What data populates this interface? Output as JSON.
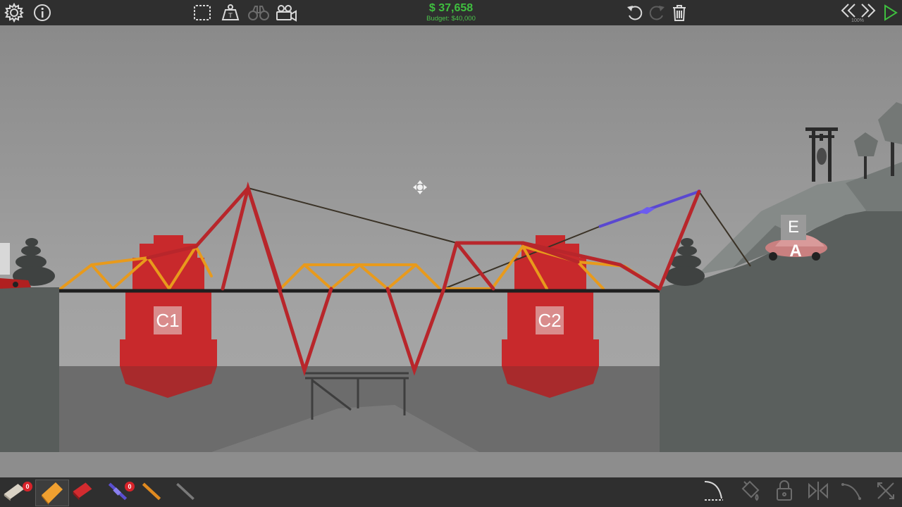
{
  "hud": {
    "money": "$ 37,658",
    "budget_label": "Budget: $40,000",
    "sim_speed": "100%"
  },
  "toolbar_top": {
    "left": [
      {
        "name": "settings-gear-icon",
        "interactable": true
      },
      {
        "name": "info-icon",
        "interactable": true
      }
    ],
    "center": [
      {
        "name": "select-box-icon",
        "interactable": true
      },
      {
        "name": "weight-icon",
        "interactable": true
      },
      {
        "name": "binoculars-icon",
        "interactable": true
      },
      {
        "name": "camera-icon",
        "interactable": true
      }
    ],
    "right": [
      {
        "name": "undo-icon",
        "interactable": true
      },
      {
        "name": "redo-icon",
        "interactable": true
      },
      {
        "name": "trash-icon",
        "interactable": true
      },
      {
        "name": "slow-down-icon",
        "interactable": true
      },
      {
        "name": "speed-up-icon",
        "interactable": true
      },
      {
        "name": "play-icon",
        "interactable": true
      }
    ]
  },
  "materials": [
    {
      "name": "road-material",
      "count": "0",
      "color": "#d9d2c5"
    },
    {
      "name": "reinforced-road-material",
      "color": "#f0a030",
      "selected": true
    },
    {
      "name": "steel-material",
      "color": "#c8232a"
    },
    {
      "name": "hydraulic-material",
      "count": "0",
      "color": "#5a4fcf"
    },
    {
      "name": "wood-material",
      "color": "#e08a20"
    },
    {
      "name": "rope-cable-material",
      "color": "#6a6a6a"
    }
  ],
  "toolbar_bottom_right": [
    "split-joint-icon",
    "paint-bucket-icon",
    "lock-icon",
    "mirror-icon",
    "curve-tool-icon",
    "close-icon"
  ],
  "anchors": {
    "pier_left": "C1",
    "pier_right": "C2",
    "checkpoint_end": "E",
    "vehicle_label": "A"
  },
  "colors": {
    "steel": "#b8262b",
    "wood": "#e89a1c",
    "road": "#1e1e1e",
    "cable": "#3a3226",
    "hydraulic": "#5a48d0",
    "water": "#6e6e6e",
    "terrain": "#5f6462",
    "pier": "#c8292c",
    "money_green": "#3fbf3f"
  }
}
